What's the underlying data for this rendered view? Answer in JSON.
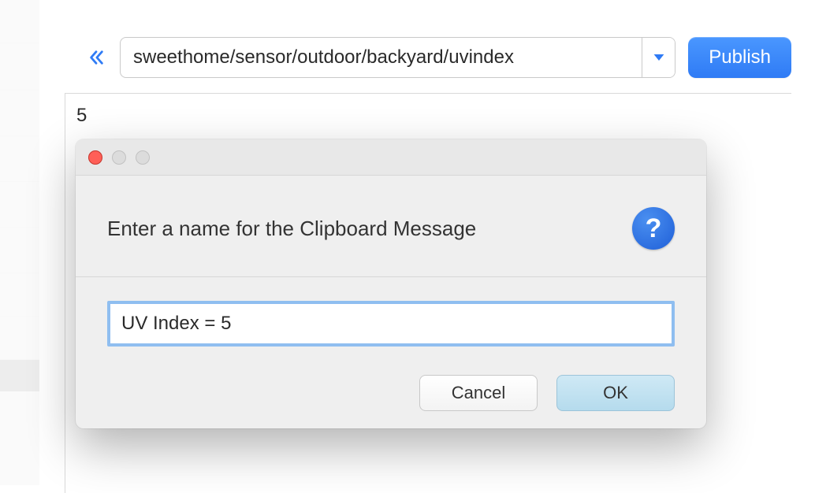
{
  "toolbar": {
    "topic_value": "sweethome/sensor/outdoor/backyard/uvindex",
    "publish_label": "Publish"
  },
  "content": {
    "message_text": "5"
  },
  "dialog": {
    "prompt": "Enter a name for the Clipboard Message",
    "help_glyph": "?",
    "input_value": "UV Index = 5",
    "cancel_label": "Cancel",
    "ok_label": "OK"
  },
  "colors": {
    "accent_blue": "#2f7bf5"
  }
}
